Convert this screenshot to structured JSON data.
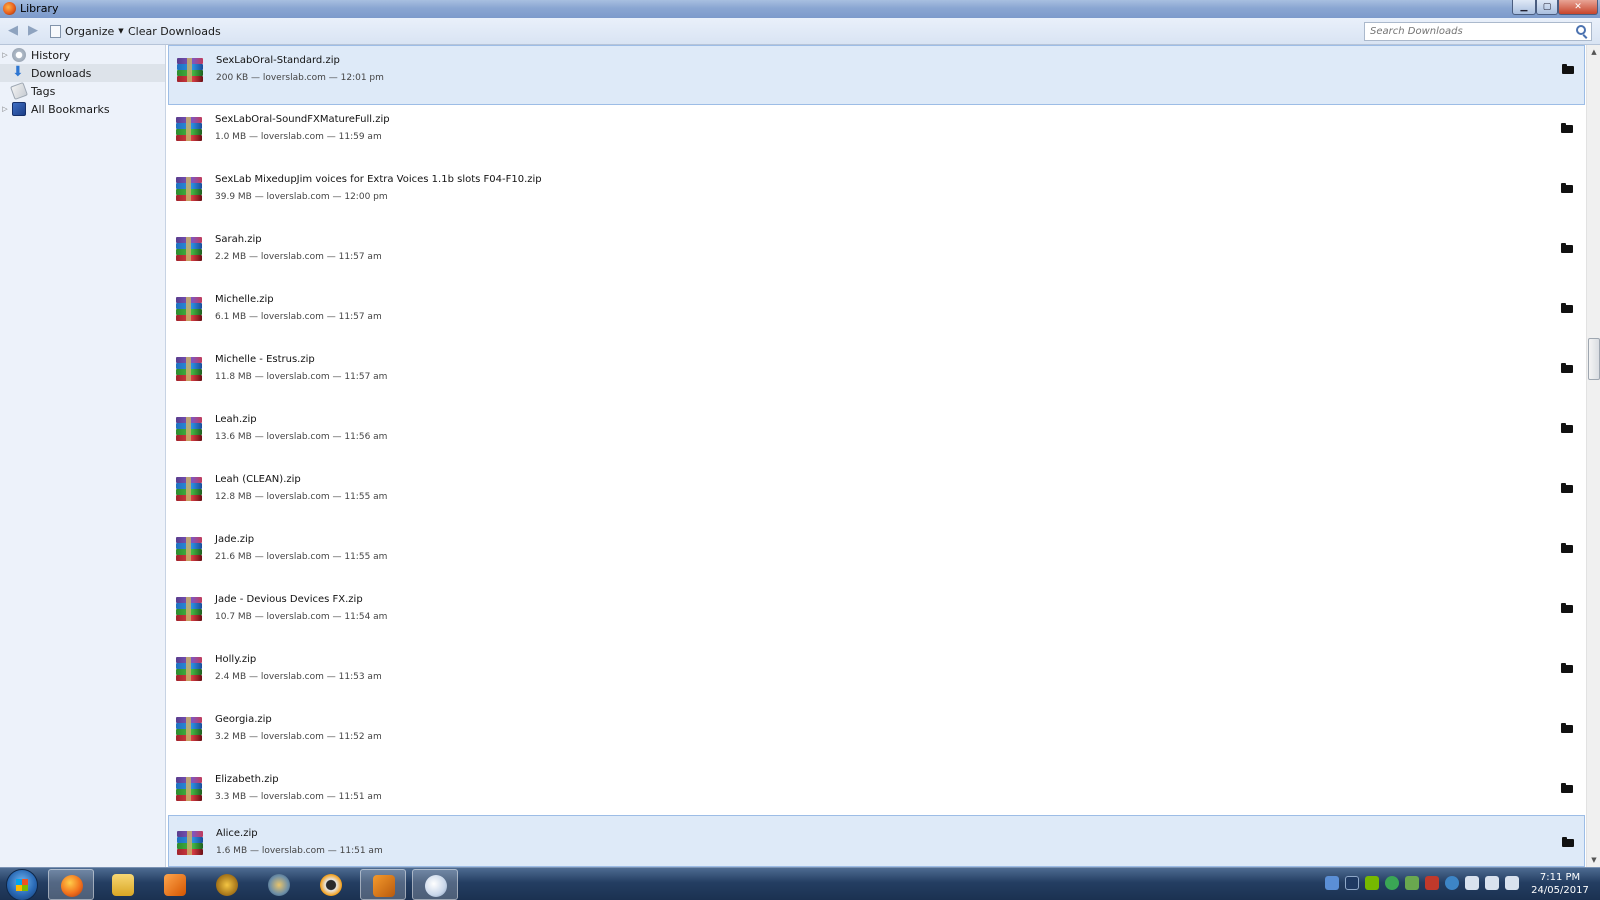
{
  "window": {
    "title": "Library"
  },
  "toolbar": {
    "organize_label": "Organize",
    "clear_label": "Clear Downloads",
    "search_placeholder": "Search Downloads"
  },
  "sidebar": {
    "items": [
      {
        "label": "History",
        "icon": "history-icon",
        "expandable": true
      },
      {
        "label": "Downloads",
        "icon": "downloads-icon",
        "expandable": false,
        "selected": true
      },
      {
        "label": "Tags",
        "icon": "tags-icon",
        "expandable": false
      },
      {
        "label": "All Bookmarks",
        "icon": "bookmarks-icon",
        "expandable": true
      }
    ]
  },
  "downloads": [
    {
      "name": "SexLabOral-Standard.zip",
      "meta": "200 KB — loverslab.com — 12:01 pm",
      "selected": true
    },
    {
      "name": "SexLabOral-SoundFXMatureFull.zip",
      "meta": "1.0 MB — loverslab.com — 11:59 am"
    },
    {
      "name": "SexLab MixedupJim voices for Extra Voices 1.1b slots F04-F10.zip",
      "meta": "39.9 MB — loverslab.com — 12:00 pm"
    },
    {
      "name": "Sarah.zip",
      "meta": "2.2 MB — loverslab.com — 11:57 am"
    },
    {
      "name": "Michelle.zip",
      "meta": "6.1 MB — loverslab.com — 11:57 am"
    },
    {
      "name": "Michelle - Estrus.zip",
      "meta": "11.8 MB — loverslab.com — 11:57 am"
    },
    {
      "name": "Leah.zip",
      "meta": "13.6 MB — loverslab.com — 11:56 am"
    },
    {
      "name": "Leah (CLEAN).zip",
      "meta": "12.8 MB — loverslab.com — 11:55 am"
    },
    {
      "name": "Jade.zip",
      "meta": "21.6 MB — loverslab.com — 11:55 am"
    },
    {
      "name": "Jade - Devious Devices FX.zip",
      "meta": "10.7 MB — loverslab.com — 11:54 am"
    },
    {
      "name": "Holly.zip",
      "meta": "2.4 MB — loverslab.com — 11:53 am"
    },
    {
      "name": "Georgia.zip",
      "meta": "3.2 MB — loverslab.com — 11:52 am"
    },
    {
      "name": "Elizabeth.zip",
      "meta": "3.3 MB — loverslab.com — 11:51 am"
    },
    {
      "name": "Alice.zip",
      "meta": "1.6 MB — loverslab.com — 11:51 am",
      "selected": true
    }
  ],
  "taskbar": {
    "apps": [
      {
        "name": "firefox",
        "active": true
      },
      {
        "name": "explorer"
      },
      {
        "name": "media-player"
      },
      {
        "name": "world-of-warcraft"
      },
      {
        "name": "app-wheel"
      },
      {
        "name": "overwatch"
      },
      {
        "name": "x-app",
        "active": true
      },
      {
        "name": "paint",
        "active": true
      }
    ],
    "clock": {
      "time": "7:11 PM",
      "date": "24/05/2017"
    }
  },
  "colors": {
    "selection": "#deeaf8",
    "sidebar_bg": "#edf2fa",
    "taskbar": "#243e62"
  }
}
